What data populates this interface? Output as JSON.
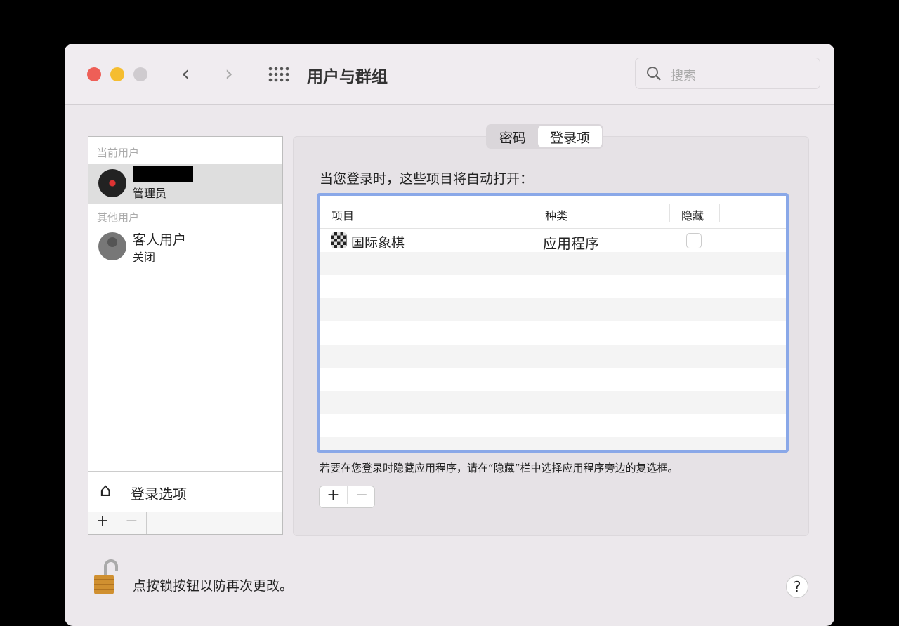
{
  "window": {
    "title": "用户与群组",
    "search_placeholder": "搜索"
  },
  "sidebar": {
    "current_section": "当前用户",
    "current_user": {
      "role": "管理员"
    },
    "other_section": "其他用户",
    "guest": {
      "name": "客人用户",
      "status": "关闭"
    },
    "login_options": "登录选项",
    "add": "+",
    "remove": "−"
  },
  "tabs": [
    {
      "label": "密码"
    },
    {
      "label": "登录项",
      "selected": true
    }
  ],
  "login_items": {
    "heading": "当您登录时，这些项目将自动打开：",
    "columns": [
      "项目",
      "种类",
      "隐藏"
    ],
    "rows": [
      {
        "item": "国际象棋",
        "kind": "应用程序",
        "hidden": false
      }
    ],
    "hint": "若要在您登录时隐藏应用程序，请在“隐藏”栏中选择应用程序旁边的复选框。",
    "add": "+",
    "remove": "−"
  },
  "footer": {
    "lock_text": "点按锁按钮以防再次更改。",
    "help": "?"
  }
}
